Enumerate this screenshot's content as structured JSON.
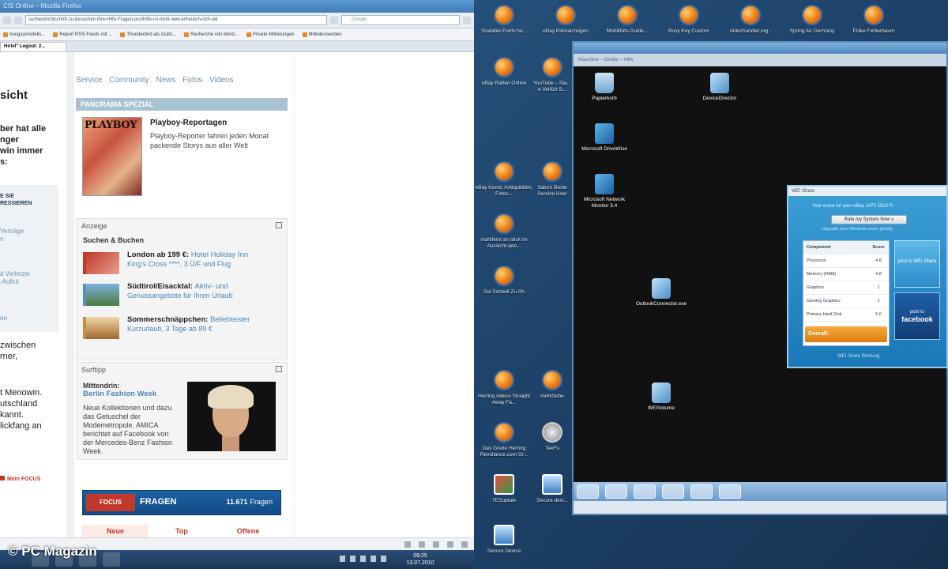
{
  "browser": {
    "title": "CIS Online – Mozilla Firefox",
    "url": "suchecklichtschrift-zu-besuchen-ihre-Hilfe-Fragen-pcs/hilfe-ist-nicht-weit-erfreulich-rich-vid",
    "search_placeholder": "Google",
    "bookmarks": [
      "nungsumodells...",
      "Report RSS-Feeds mit ...",
      "Thunderbird als Outlo...",
      "Recherche von Mord...",
      "Private Mitteilungen",
      "Mitteilensenden"
    ],
    "tab_label": "Hirtel\" Logout: 2...",
    "left_column": {
      "headline": "sicht",
      "para": "ber hat alle\nnger\nwin immer\ns:",
      "box_title": "E SIE\nRESSIEREN",
      "links": [
        "Verträge\nn",
        "d Verletzte\n-Auftrit",
        "en"
      ],
      "para2": "zwischen\nrner,",
      "para3": "t Menowin.\nutschland\nkannt.\nlickfang an",
      "focus_link": "Mein FOCUS"
    },
    "topnav": [
      "Service",
      "Community",
      "News",
      "Fotos",
      "Videos"
    ],
    "panorama": {
      "bar_label": "PANORAMA SPEZIAL",
      "cover_logo": "PLAYBOY",
      "title": "Playboy-Reportagen",
      "text": "Playboy-Reporter fahren jeden Monat packende Storys aus aller Welt"
    },
    "anzeige": {
      "header": "Anzeige",
      "subheader": "Suchen & Buchen",
      "ads": [
        {
          "title": "London ab 199 €:",
          "inline": "Hotel Holiday Inn",
          "more": "King's Cross ****, 3 Ü/F und Flug",
          "color": "#c0392b"
        },
        {
          "title": "Südtirol/Eisacktal:",
          "inline": "Aktiv- und",
          "more": "Genussangebote für Ihren Urlaub",
          "color": "#5b8db8"
        },
        {
          "title": "Sommerschnäppchen:",
          "inline": "Beliebtester",
          "more": "Kurzurlaub, 3 Tage ab 89 €",
          "color": "#c98e3b"
        }
      ]
    },
    "surftipp": {
      "header": "Surftipp",
      "kicker": "Mittendrin:",
      "title": "Berlin Fashion Week",
      "text": "Neue Kollektionen und dazu das Getuschel der Modemetropole. AMICA berichtet auf Facebook von der Mercedes-Benz Fashion Week."
    },
    "fragen": {
      "logo": "FOCUS",
      "word": "FRAGEN",
      "count": "11.671",
      "count_label": "Fragen",
      "tabs": [
        "Neue",
        "Top",
        "Offene"
      ]
    }
  },
  "taskbar": {
    "clock_time": "09:25",
    "clock_date": "13.07.2010"
  },
  "watermark": "© PC Magazin",
  "desktop": {
    "icons": [
      {
        "label": "Scalable-Fonts ha..."
      },
      {
        "label": "eBay Kleinanzeigen"
      },
      {
        "label": "Mobilitäts-Guide..."
      },
      {
        "label": "Busy Key Custom"
      },
      {
        "label": "Aldezhandler.org -"
      },
      {
        "label": "Spring Air Germany"
      },
      {
        "label": "Ebike Fehlerbaum"
      },
      {
        "label": "eBay Ratten Online"
      },
      {
        "label": "YouTube – Sta... e Verfürt S..."
      },
      {
        "label": "eBay Kunst, Antiquitäten, Fotos..."
      },
      {
        "label": "Saturn Beste Service User"
      },
      {
        "label": "mahlferst an stick im Aussicht-gee..."
      },
      {
        "label": "Sei Schnell Zu Sh"
      },
      {
        "label": "Herring videos Straight Away Fa..."
      },
      {
        "label": "mehrfarbe"
      },
      {
        "label": "Das Grede Herring Revollance.com Gr..."
      },
      {
        "label": "TeeFu"
      },
      {
        "label": "TESuptale"
      },
      {
        "label": "Secure devi..."
      },
      {
        "label": "Secure Device"
      }
    ],
    "vm": {
      "menu": "Maschine – Geräte – Hilfe",
      "icons": [
        {
          "label": "Papierkorb"
        },
        {
          "label": "DeviceDirector"
        },
        {
          "label": "Microsoft DriveWise"
        },
        {
          "label": "Microsoft Network Monitor 3.4"
        },
        {
          "label": "OutlookConnector.exe"
        },
        {
          "label": "WEIVolume"
        }
      ]
    },
    "wei": {
      "title": "WEI Share",
      "top_text": "Your score for your eBay 1470 2010 Fr",
      "button": "Rate my System Now »",
      "sub_text": "Upgrade your Windows score greatly",
      "headers": [
        "Component",
        "Score"
      ],
      "rows": [
        {
          "name": "Processor",
          "score": "4.8"
        },
        {
          "name": "Memory (RAM)",
          "score": "4.8"
        },
        {
          "name": "Graphics",
          "score": "1"
        },
        {
          "name": "Gaming Graphics",
          "score": "1"
        },
        {
          "name": "Primary Hard Disk",
          "score": "5.6"
        }
      ],
      "overall": "Overall:",
      "side1": "post to WEI Share",
      "side2_top": "post to",
      "side2_bold": "facebook",
      "bottom_link": "WEI Share Wertung"
    }
  }
}
